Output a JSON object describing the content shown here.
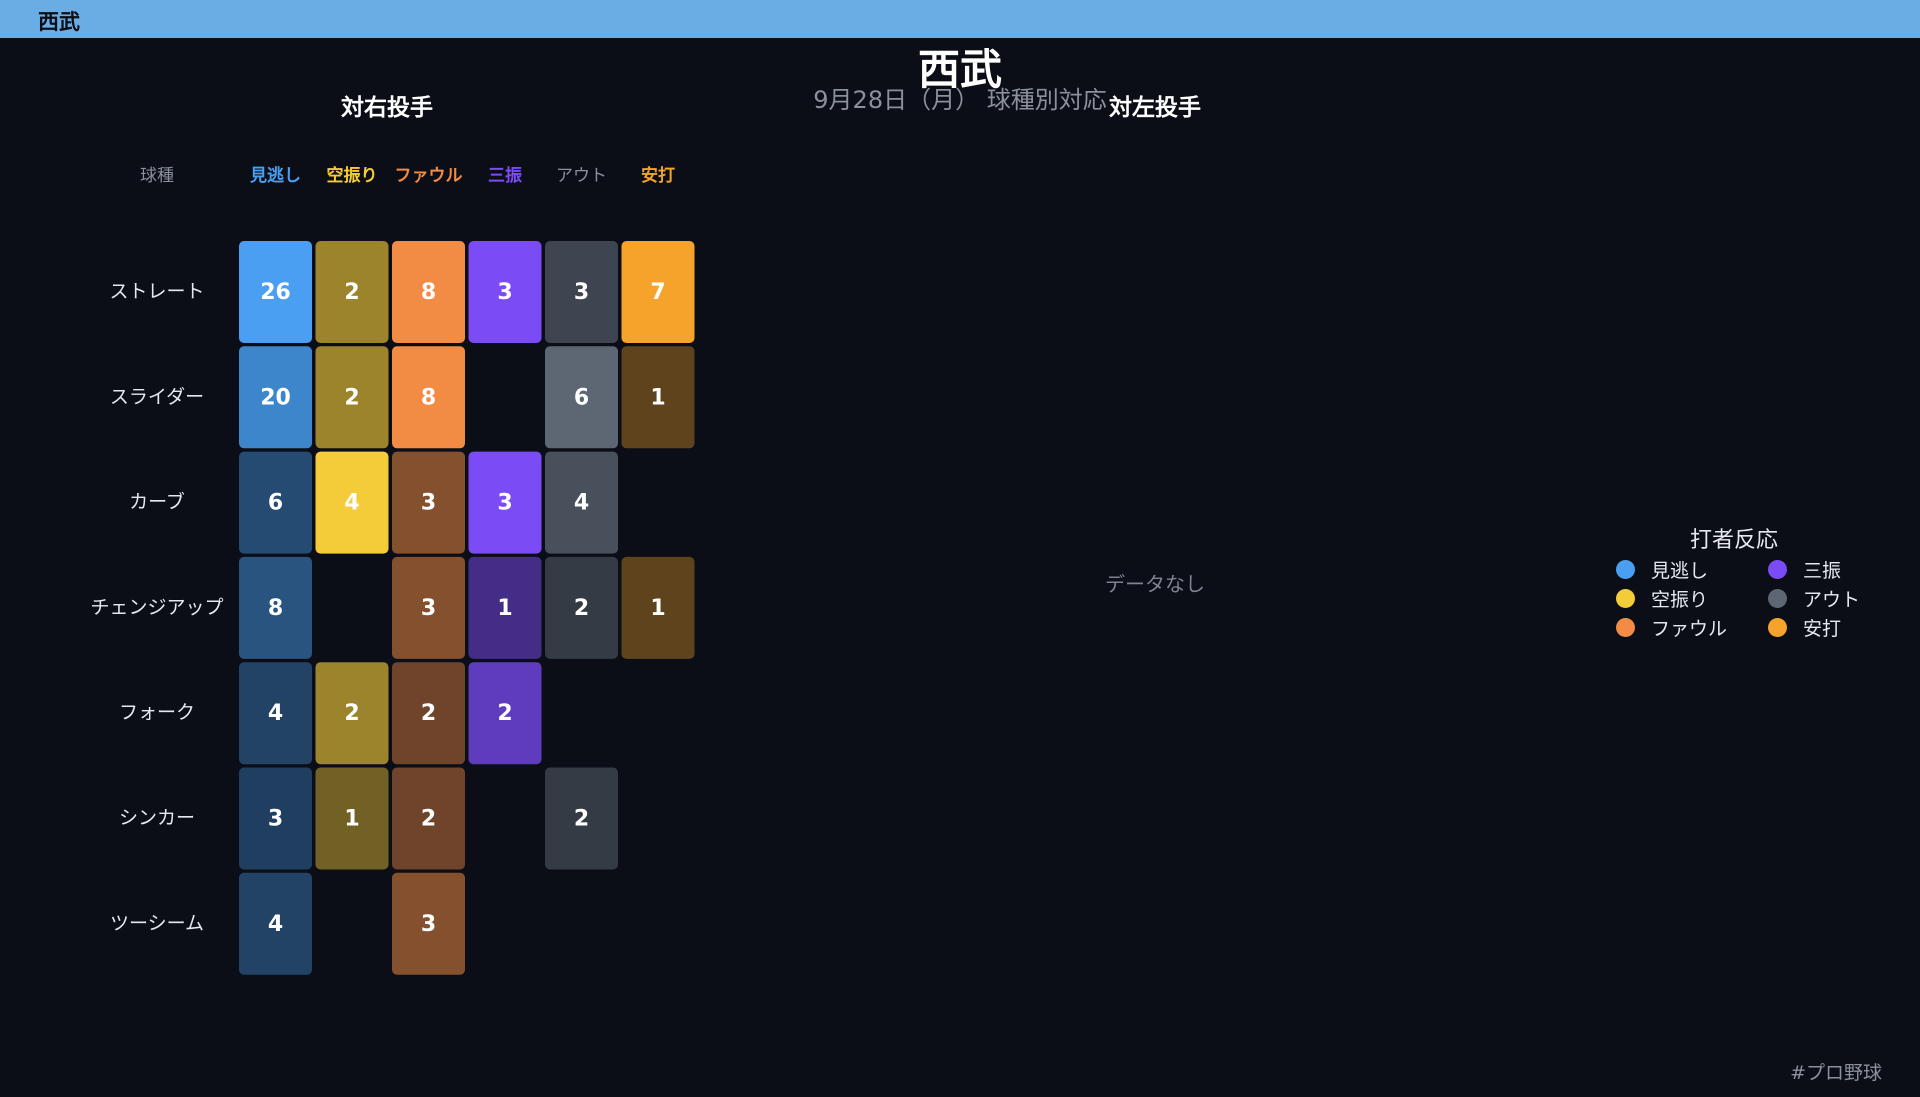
{
  "window": {
    "title": "西武"
  },
  "header": {
    "title": "西武",
    "subtitle": "9月28日（月） 球種別対応"
  },
  "panels": {
    "right_title": "対右投手",
    "left_title": "対左投手",
    "left_no_data": "データなし"
  },
  "colors": {
    "title_bar": "#6aade4",
    "background": "#0b0e16",
    "miss": "#4a9ff2",
    "swing": "#f4cc3a",
    "foul": "#f28b44",
    "strikeout": "#7b4cf5",
    "out": "#5d6774",
    "hit": "#f5a32a"
  },
  "chart_data": {
    "type": "heatmap",
    "title": "対右投手",
    "row_header": "球種",
    "categories": [
      "見逃し",
      "空振り",
      "ファウル",
      "三振",
      "アウト",
      "安打"
    ],
    "category_colors": [
      "#4a9ff2",
      "#f4cc3a",
      "#f28b44",
      "#7b4cf5",
      "#5d6774",
      "#f5a32a"
    ],
    "column_header_colors": [
      "#4a9ff2",
      "#f4cc3a",
      "#f28b44",
      "#7b4cf5",
      "#8a909c",
      "#f5a32a"
    ],
    "rows": [
      "ストレート",
      "スライダー",
      "カーブ",
      "チェンジアップ",
      "フォーク",
      "シンカー",
      "ツーシーム"
    ],
    "values": [
      [
        26,
        2,
        8,
        3,
        3,
        7
      ],
      [
        20,
        2,
        8,
        null,
        6,
        1
      ],
      [
        6,
        4,
        3,
        3,
        4,
        null
      ],
      [
        8,
        null,
        3,
        1,
        2,
        1
      ],
      [
        4,
        2,
        2,
        2,
        null,
        null
      ],
      [
        3,
        1,
        2,
        null,
        2,
        null
      ],
      [
        4,
        null,
        3,
        null,
        null,
        null
      ]
    ]
  },
  "legend": {
    "title": "打者反応",
    "items": [
      {
        "label": "見逃し",
        "color": "#4a9ff2"
      },
      {
        "label": "三振",
        "color": "#7b4cf5"
      },
      {
        "label": "空振り",
        "color": "#f4cc3a"
      },
      {
        "label": "アウト",
        "color": "#5d6774"
      },
      {
        "label": "ファウル",
        "color": "#f28b44"
      },
      {
        "label": "安打",
        "color": "#f5a32a"
      }
    ]
  },
  "footer": {
    "hashtag": "#プロ野球"
  }
}
